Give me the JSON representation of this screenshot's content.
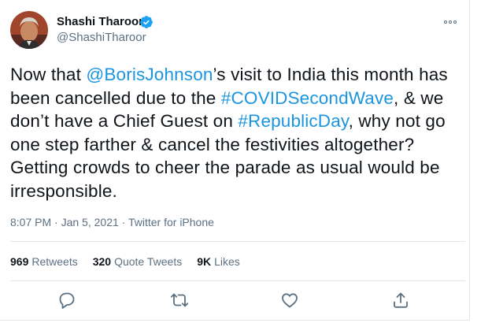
{
  "tweet": {
    "author": {
      "name": "Shashi Tharoor",
      "handle": "@ShashiTharoor",
      "verified": true
    },
    "text": {
      "p1": "Now that ",
      "mention": "@BorisJohnson",
      "p2": "’s visit to India this month has been cancelled due to the ",
      "hashtag1": "#COVIDSecondWave",
      "p3": ", & we don’t have a Chief Guest on ",
      "hashtag2": "#RepublicDay",
      "p4": ", why not go one step farther & cancel the festivities altogether? Getting crowds to cheer the parade as usual would be irresponsible."
    },
    "time": "8:07 PM",
    "date": "Jan 5, 2021",
    "source": "Twitter for iPhone",
    "separator": "·",
    "stats": {
      "retweets_count": "969",
      "retweets_label": "Retweets",
      "quotes_count": "320",
      "quotes_label": "Quote Tweets",
      "likes_count": "9K",
      "likes_label": "Likes"
    },
    "actions": [
      "reply-icon",
      "retweet-icon",
      "like-icon",
      "share-icon"
    ]
  },
  "colors": {
    "link": "#1b95e0",
    "secondary_text": "#5b7083",
    "primary_text": "#0f1419",
    "divider": "#e1e8ed",
    "verified_badge": "#1da1f2"
  }
}
